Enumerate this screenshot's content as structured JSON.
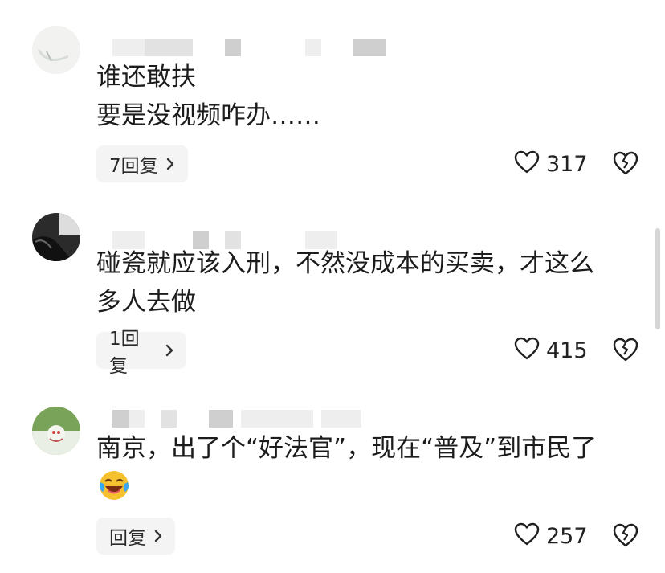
{
  "comments": [
    {
      "text": "谁还敢扶\n要是没视频咋办……",
      "reply_label": "7回复",
      "likes": "317"
    },
    {
      "text": "碰瓷就应该入刑，不然没成本的买卖，才这么\n多人去做",
      "reply_label": "1回复",
      "likes": "415"
    },
    {
      "text": "南京，出了个“好法官”，现在“普及”到市民了",
      "emoji": "crying-laughing-emoji",
      "reply_label": "回复",
      "likes": "257"
    }
  ],
  "icons": {
    "like": "heart-outline-icon",
    "dislike": "broken-heart-icon",
    "chevron": "chevron-right-icon"
  }
}
